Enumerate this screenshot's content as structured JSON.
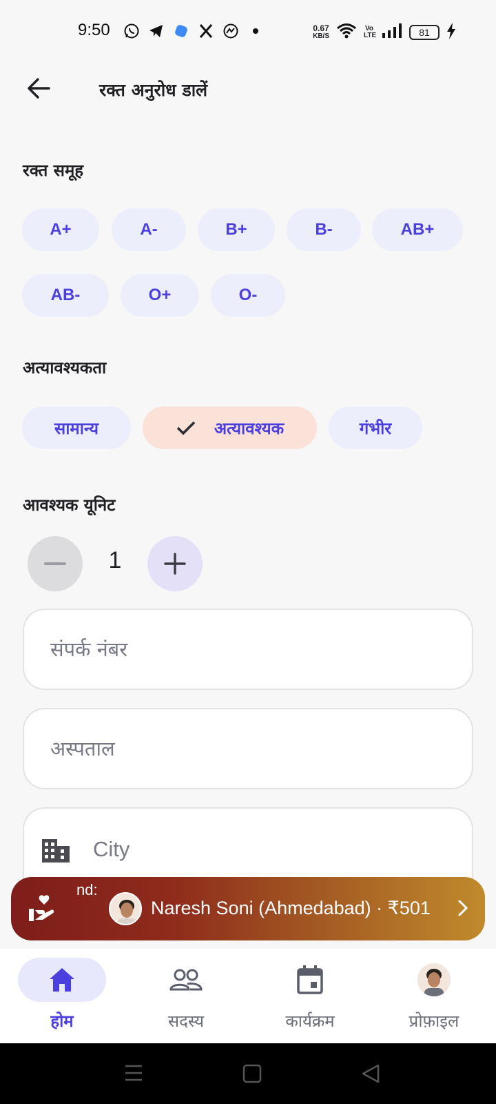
{
  "status_bar": {
    "time": "9:50",
    "speed_value": "0.67",
    "speed_unit": "KB/S",
    "volte": "Vo LTE",
    "battery": "81",
    "left_icons": [
      "whatsapp-icon",
      "telegram-icon",
      "app-icon",
      "x-icon",
      "messenger-icon",
      "dot-icon"
    ],
    "right_icons": [
      "wifi-icon",
      "signal-icon",
      "charging-icon"
    ]
  },
  "header": {
    "title": "रक्त अनुरोध डालें",
    "back_icon": "arrow-left-icon"
  },
  "blood_group": {
    "label": "रक्त समूह",
    "options": [
      "A+",
      "A-",
      "B+",
      "B-",
      "AB+",
      "AB-",
      "O+",
      "O-"
    ]
  },
  "urgency": {
    "label": "अत्यावश्यकता",
    "options": [
      "सामान्य",
      "अत्यावश्यक",
      "गंभीर"
    ],
    "selected": "अत्यावश्यक"
  },
  "units": {
    "label": "आवश्यक यूनिट",
    "value": "1"
  },
  "form": {
    "contact_placeholder": "संपर्क नंबर",
    "hospital_placeholder": "अस्पताल",
    "city_placeholder": "City"
  },
  "banner": {
    "prefix": "nd:",
    "text": "Naresh Soni (Ahmedabad) · ₹501",
    "icon": "donate-heart-icon"
  },
  "bottom_nav": {
    "items": [
      {
        "label": "होम",
        "icon": "home-icon",
        "active": true
      },
      {
        "label": "सदस्य",
        "icon": "members-icon",
        "active": false
      },
      {
        "label": "कार्यक्रम",
        "icon": "calendar-icon",
        "active": false
      },
      {
        "label": "प्रोफ़ाइल",
        "icon": "avatar",
        "active": false
      }
    ]
  },
  "colors": {
    "accent": "#4b3fe0",
    "chip_bg": "#eceefb",
    "selected_chip_bg": "#fbe2d9",
    "banner_start": "#7e1d1a",
    "banner_end": "#c08a2c"
  }
}
